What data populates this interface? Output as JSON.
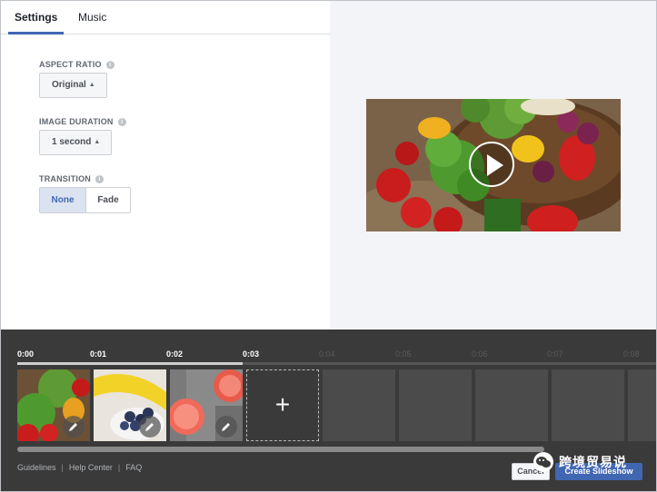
{
  "tabs": [
    {
      "label": "Settings",
      "active": true
    },
    {
      "label": "Music",
      "active": false
    }
  ],
  "settings": {
    "aspect_ratio": {
      "label": "ASPECT RATIO",
      "value": "Original"
    },
    "image_duration": {
      "label": "IMAGE DURATION",
      "value": "1 second"
    },
    "transition": {
      "label": "TRANSITION",
      "options": [
        "None",
        "Fade"
      ],
      "selected": "None"
    }
  },
  "timeline": {
    "ticks": [
      "0:00",
      "0:01",
      "0:02",
      "0:03",
      "0:04",
      "0:05",
      "0:06",
      "0:07",
      "0:08"
    ],
    "filled_ticks": 4,
    "add_label": "+"
  },
  "footer": {
    "links": [
      "Guidelines",
      "Help Center",
      "FAQ"
    ],
    "cancel": "Cancel",
    "create": "Create Slideshow"
  },
  "watermark": {
    "text": "跨境贸易说"
  },
  "colors": {
    "accent": "#4267b2",
    "panel": "#3a3a3a",
    "preview_bg": "#f3f4f7"
  }
}
